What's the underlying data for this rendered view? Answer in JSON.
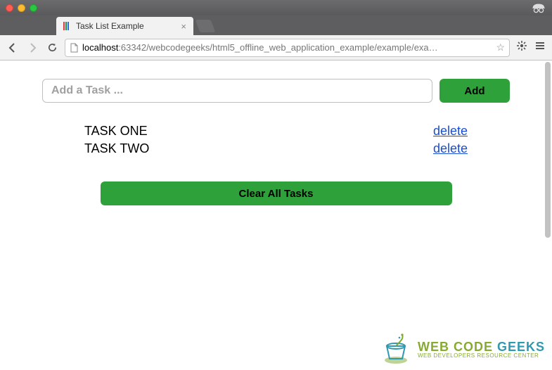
{
  "window": {
    "tab_title": "Task List Example"
  },
  "toolbar": {
    "url_host": "localhost",
    "url_rest": ":63342/webcodegeeks/html5_offline_web_application_example/example/exa…"
  },
  "app": {
    "input_placeholder": "Add a Task ...",
    "add_label": "Add",
    "clear_label": "Clear All Tasks",
    "delete_label": "delete",
    "tasks": [
      {
        "name": "TASK ONE"
      },
      {
        "name": "TASK TWO"
      }
    ]
  },
  "watermark": {
    "brand_part1": "WEB CODE ",
    "brand_part2": "GEEKS",
    "tagline": "WEB DEVELOPERS RESOURCE CENTER"
  }
}
